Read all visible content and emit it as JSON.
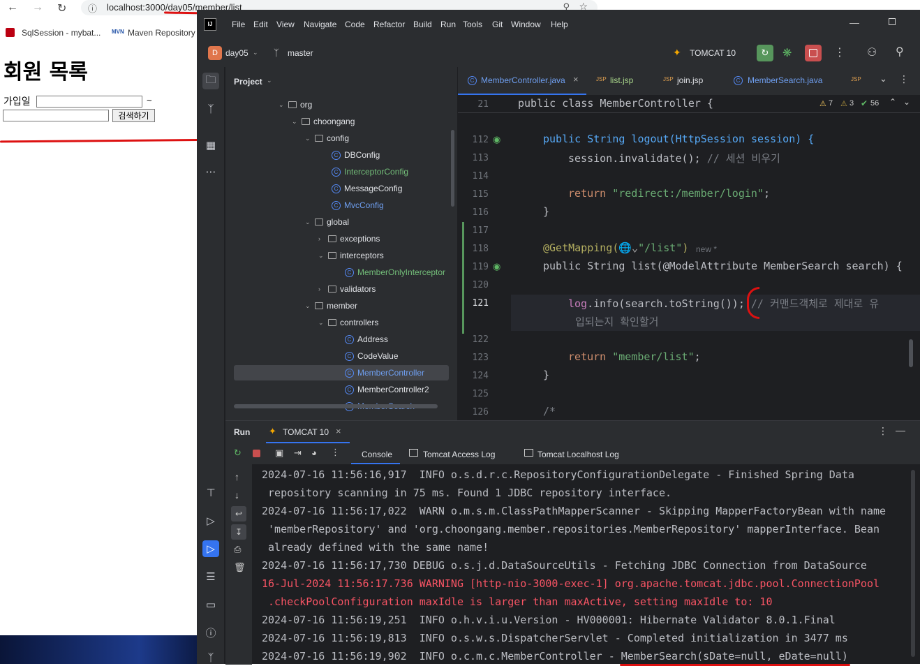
{
  "browser": {
    "url": "localhost:3000/day05/member/list",
    "bookmarks": [
      "SqlSession - mybat...",
      "Maven Repository"
    ],
    "page": {
      "title": "회원 목록",
      "join_label": "가입일",
      "tilde": "~",
      "search_button": "검색하기"
    }
  },
  "ide": {
    "menu": [
      "File",
      "Edit",
      "View",
      "Navigate",
      "Code",
      "Refactor",
      "Build",
      "Run",
      "Tools",
      "Git",
      "Window",
      "Help"
    ],
    "project_badge": "D",
    "project_name": "day05",
    "branch": "master",
    "run_config": "TOMCAT 10",
    "panel_title": "Project",
    "tree": [
      {
        "label": "org",
        "type": "folder"
      },
      {
        "label": "choongang",
        "type": "folder"
      },
      {
        "label": "config",
        "type": "folder"
      },
      {
        "label": "DBConfig",
        "type": "class"
      },
      {
        "label": "InterceptorConfig",
        "type": "class"
      },
      {
        "label": "MessageConfig",
        "type": "class"
      },
      {
        "label": "MvcConfig",
        "type": "class"
      },
      {
        "label": "global",
        "type": "folder"
      },
      {
        "label": "exceptions",
        "type": "folder"
      },
      {
        "label": "interceptors",
        "type": "folder"
      },
      {
        "label": "MemberOnlyInterceptor",
        "type": "class"
      },
      {
        "label": "validators",
        "type": "folder"
      },
      {
        "label": "member",
        "type": "folder"
      },
      {
        "label": "controllers",
        "type": "folder"
      },
      {
        "label": "Address",
        "type": "class"
      },
      {
        "label": "CodeValue",
        "type": "class"
      },
      {
        "label": "MemberController",
        "type": "class"
      },
      {
        "label": "MemberController2",
        "type": "class"
      },
      {
        "label": "MemberSearch",
        "type": "class"
      }
    ],
    "editor_tabs": [
      "MemberController.java",
      "list.jsp",
      "join.jsp",
      "MemberSearch.java"
    ],
    "inspections": {
      "warnings": "7",
      "weak": "3",
      "ok": "56"
    },
    "sticky_line": {
      "num": "21",
      "text": "public class MemberController {"
    },
    "code_lines": [
      "112",
      "113",
      "114",
      "115",
      "116",
      "117",
      "118",
      "119",
      "120",
      "121",
      "122",
      "123",
      "124",
      "125",
      "126"
    ],
    "code": {
      "l112": "public String logout(HttpSession session) {",
      "l113a": "session.invalidate(); ",
      "l113b": "// 세션 비우기",
      "l115a": "return ",
      "l115b": "\"redirect:/member/login\"",
      "l115c": ";",
      "l116": "}",
      "l118a": "@GetMapping(",
      "l118b": "\"/list\"",
      "l118c": ")",
      "l118d": "new *",
      "l119": "public String list(@ModelAttribute MemberSearch search) {",
      "l121a": "log",
      "l121b": ".info(search.toString()); ",
      "l121c": "// 커맨드객체로 제대로 유",
      "l121d": "입되는지 확인할거",
      "l123a": "return ",
      "l123b": "\"member/list\"",
      "l123c": ";",
      "l124": "}",
      "l126": "/*"
    },
    "run": {
      "title": "Run",
      "tab": "TOMCAT 10",
      "subtabs": [
        "Console",
        "Tomcat Access Log",
        "Tomcat Localhost Log"
      ],
      "log": [
        "2024-07-16 11:56:16,917  INFO o.s.d.r.c.RepositoryConfigurationDelegate - Finished Spring Data",
        " repository scanning in 75 ms. Found 1 JDBC repository interface.",
        "2024-07-16 11:56:17,022  WARN o.m.s.m.ClassPathMapperScanner - Skipping MapperFactoryBean with name",
        " 'memberRepository' and 'org.choongang.member.repositories.MemberRepository' mapperInterface. Bean",
        " already defined with the same name!",
        "2024-07-16 11:56:17,730 DEBUG o.s.j.d.DataSourceUtils - Fetching JDBC Connection from DataSource",
        "16-Jul-2024 11:56:17.736 WARNING [http-nio-3000-exec-1] org.apache.tomcat.jdbc.pool.ConnectionPool",
        " .checkPoolConfiguration maxIdle is larger than maxActive, setting maxIdle to: 10",
        "2024-07-16 11:56:19,251  INFO o.h.v.i.u.Version - HV000001: Hibernate Validator 8.0.1.Final",
        "2024-07-16 11:56:19,813  INFO o.s.w.s.DispatcherServlet - Completed initialization in 3477 ms",
        "2024-07-16 11:56:19,902  INFO o.c.m.c.MemberController - MemberSearch(sDate=null, eDate=null)"
      ]
    }
  }
}
